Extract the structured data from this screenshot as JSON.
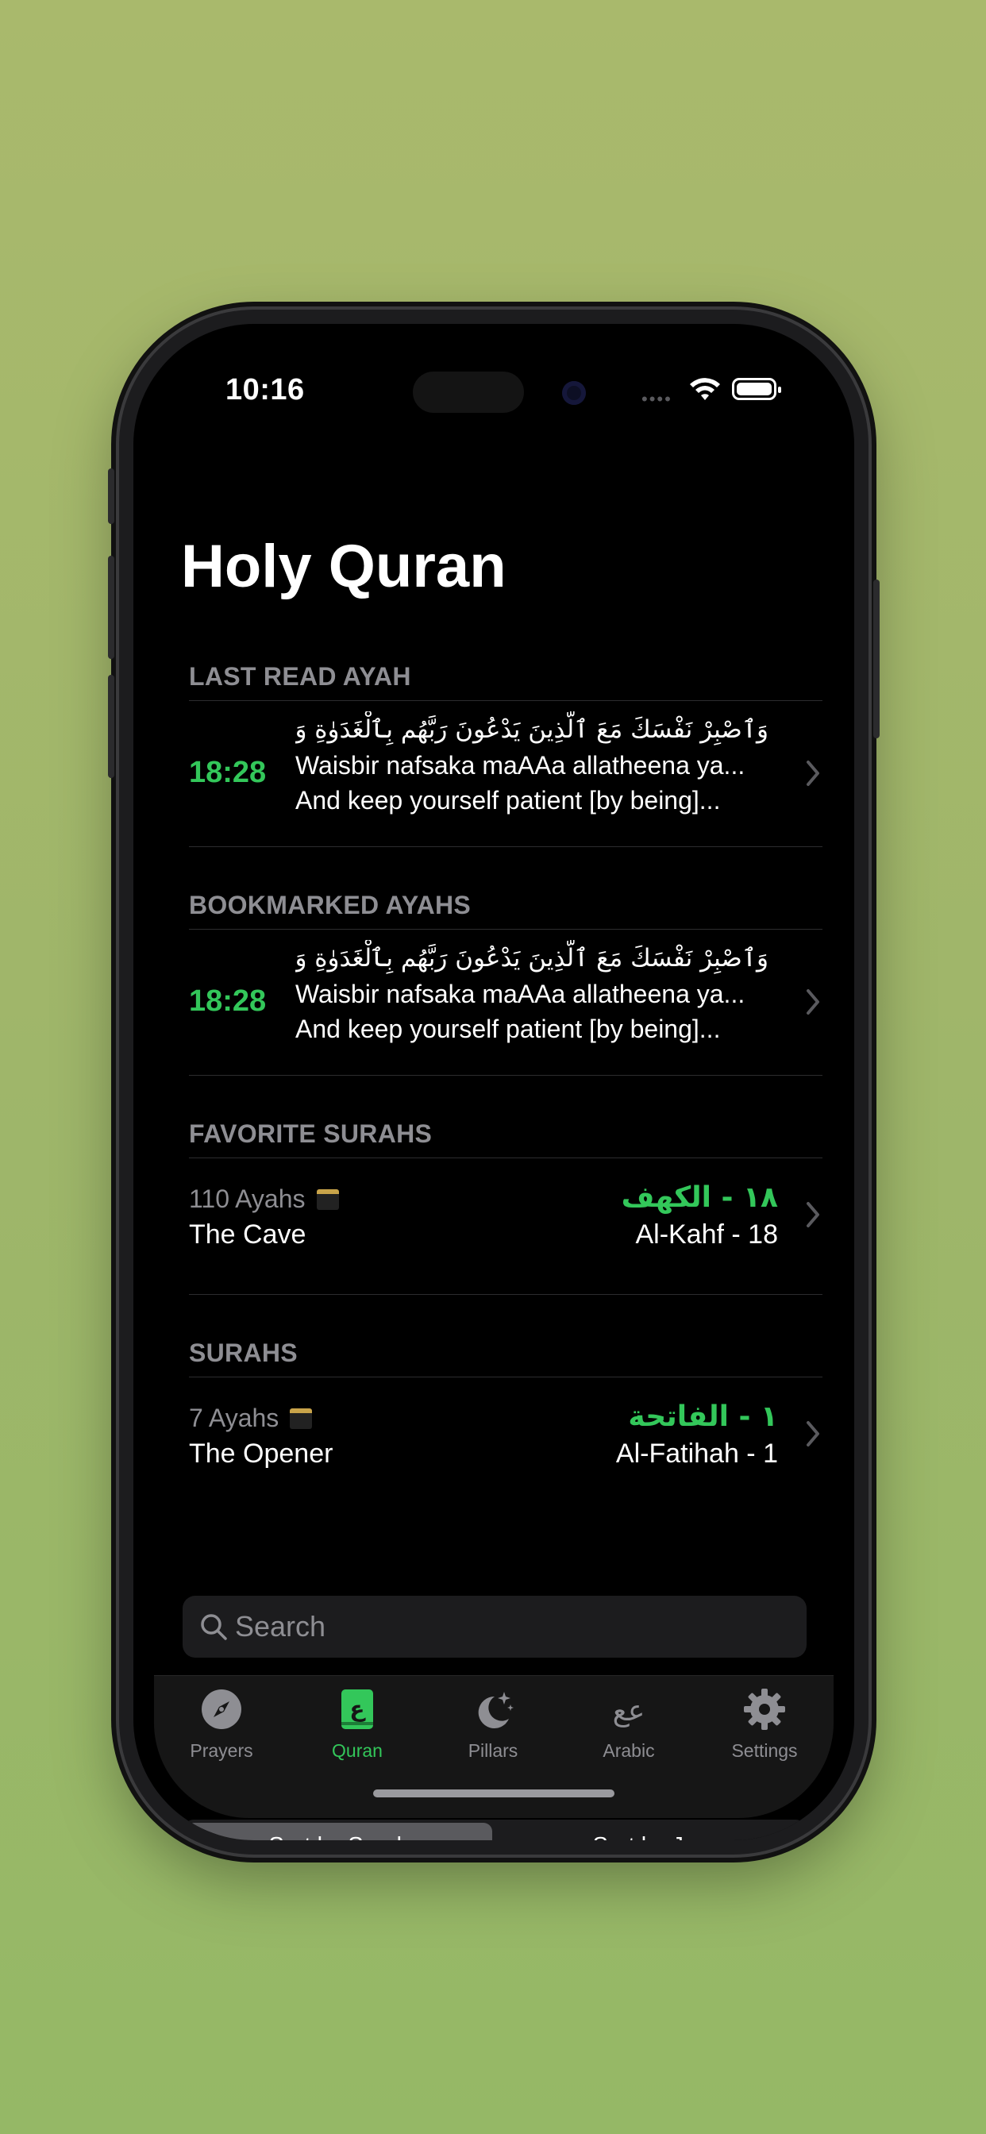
{
  "status_bar": {
    "time": "10:16"
  },
  "page_title": "Holy Quran",
  "sections": {
    "last_read": "LAST READ AYAH",
    "bookmarked": "BOOKMARKED AYAHS",
    "favorites": "FAVORITE SURAHS",
    "surahs": "SURAHS"
  },
  "last_read": {
    "ref": "18:28",
    "arabic": "وَٱصْبِرْ نَفْسَكَ مَعَ ٱلَّذِينَ يَدْعُونَ رَبَّهُم بِٱلْغَدَوٰةِ وَٱ...",
    "transliteration": "Waisbir nafsaka maAAa allatheena ya...",
    "translation": "And keep yourself patient [by being]..."
  },
  "bookmarked": {
    "ref": "18:28",
    "arabic": "وَٱصْبِرْ نَفْسَكَ مَعَ ٱلَّذِينَ يَدْعُونَ رَبَّهُم بِٱلْغَدَوٰةِ وَٱ...",
    "transliteration": "Waisbir nafsaka maAAa allatheena ya...",
    "translation": "And keep yourself patient [by being]..."
  },
  "favorite_surah": {
    "ayahs": "110 Ayahs",
    "english": "The Cave",
    "arabic": "١٨ - الكهف",
    "latin": "Al-Kahf - 18"
  },
  "surah": {
    "ayahs": "7 Ayahs",
    "english": "The Opener",
    "arabic": "١ - الفاتحة",
    "latin": "Al-Fatihah - 1"
  },
  "sort": {
    "by_surah": "Sort by Surah",
    "by_juz": "Sort by Juz",
    "selected": "Sort by Surah"
  },
  "search": {
    "placeholder": "Search"
  },
  "tabs": [
    {
      "label": "Prayers",
      "icon": "compass-icon"
    },
    {
      "label": "Quran",
      "icon": "quran-book-icon",
      "active": true
    },
    {
      "label": "Pillars",
      "icon": "moon-stars-icon"
    },
    {
      "label": "Arabic",
      "icon": "arabic-letters-icon"
    },
    {
      "label": "Settings",
      "icon": "gear-icon"
    }
  ],
  "colors": {
    "accent": "#33c75a",
    "background": "#000000",
    "secondary_text": "#8e8e93"
  }
}
